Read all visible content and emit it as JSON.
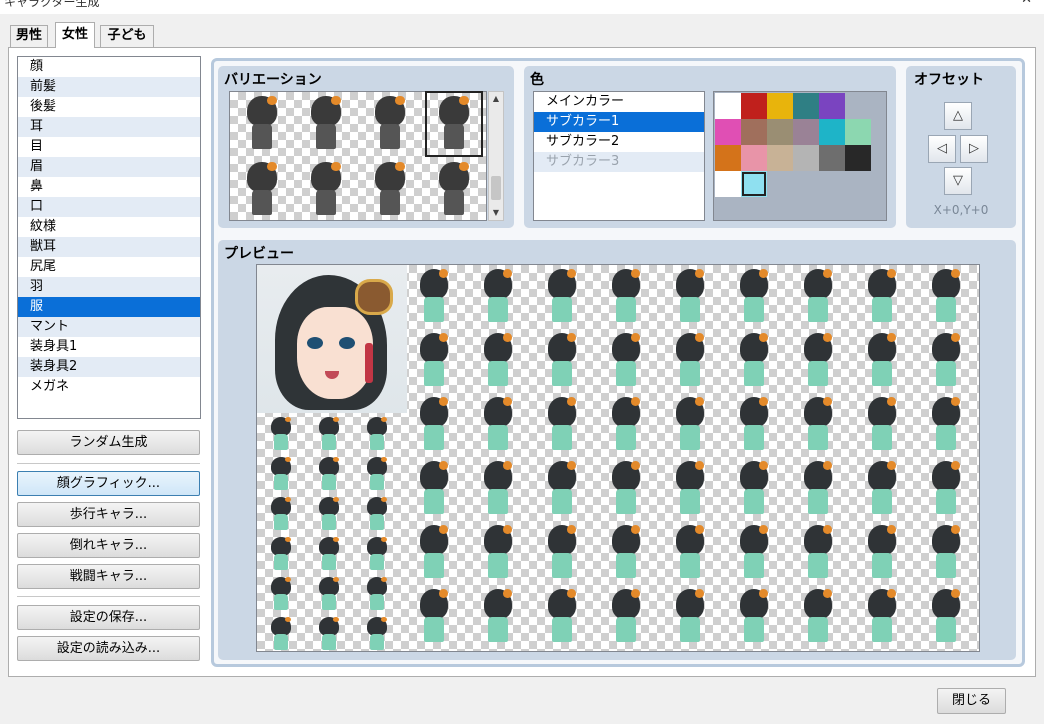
{
  "window": {
    "title": "キャラクター生成",
    "close_label": "✕"
  },
  "tabs": [
    {
      "label": "男性",
      "active": false
    },
    {
      "label": "女性",
      "active": true
    },
    {
      "label": "子ども",
      "active": false
    }
  ],
  "parts": {
    "items": [
      "顔",
      "前髪",
      "後髪",
      "耳",
      "目",
      "眉",
      "鼻",
      "口",
      "紋様",
      "獣耳",
      "尻尾",
      "羽",
      "服",
      "マント",
      "装身具1",
      "装身具2",
      "メガネ"
    ],
    "selected": "服"
  },
  "buttons": {
    "random": "ランダム生成",
    "face": "顔グラフィック...",
    "walk": "歩行キャラ...",
    "down": "倒れキャラ...",
    "battle": "戦闘キャラ...",
    "save": "設定の保存...",
    "load": "設定の読み込み...",
    "close": "閉じる"
  },
  "variation": {
    "title": "バリエーション",
    "selected_index": 3,
    "count": 8
  },
  "color": {
    "title": "色",
    "options": [
      "メインカラー",
      "サブカラー1",
      "サブカラー2",
      "サブカラー3"
    ],
    "selected": "サブカラー1",
    "disabled": [
      "サブカラー3"
    ],
    "palette": [
      [
        "#ffffff",
        "#c0201c",
        "#e8b40c",
        "#2f7f84",
        "#7a44c0"
      ],
      [
        "#e04fb4",
        "#a06f5c",
        "#9a8e73",
        "#9a8296",
        "#1eb4c8",
        "#8cd7b0"
      ],
      [
        "#d4731a",
        "#e894a8",
        "#c8b296",
        "#b4b4b4",
        "#6e6e6e",
        "#282828"
      ],
      [
        "#ffffff",
        "#8fe0f0"
      ]
    ],
    "selected_swatch": "#8fe0f0"
  },
  "offset": {
    "title": "オフセット",
    "up": "△",
    "left": "◁",
    "right": "▷",
    "down": "▽",
    "value": "X+0,Y+0"
  },
  "preview": {
    "title": "プレビュー"
  }
}
